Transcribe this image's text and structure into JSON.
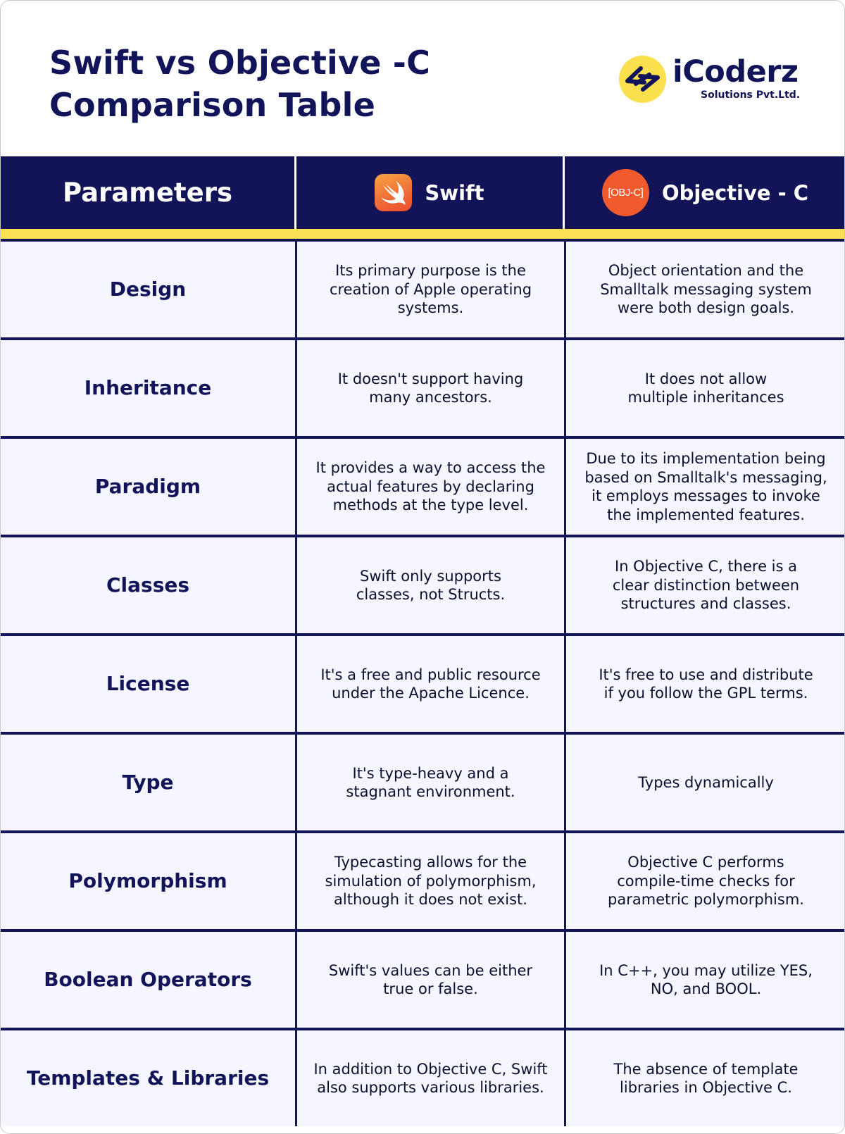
{
  "header": {
    "title_line1": "Swift vs Objective -C",
    "title_line2": "Comparison Table",
    "logo": {
      "icon": "code-brackets-icon",
      "name": "iCoderz",
      "subtitle": "Solutions Pvt.Ltd.",
      "accent_color": "#fbe04d"
    }
  },
  "table": {
    "colors": {
      "header_bg": "#121457",
      "accent_bar": "#fde255",
      "row_bg": "#f4f5fe"
    },
    "columns": [
      {
        "label": "Parameters"
      },
      {
        "label": "Swift",
        "icon": "swift-logo-icon"
      },
      {
        "label": "Objective - C",
        "icon": "objc-logo-icon",
        "icon_text": "[OBJ-C]"
      }
    ],
    "rows": [
      {
        "parameter": "Design",
        "swift": "Its primary purpose is the\ncreation of Apple operating\nsystems.",
        "objc": "Object orientation and the\nSmalltalk messaging system\nwere both design goals."
      },
      {
        "parameter": "Inheritance",
        "swift": "It doesn't support having\nmany ancestors.",
        "objc": "It does not allow\nmultiple inheritances"
      },
      {
        "parameter": "Paradigm",
        "swift": "It provides a way to access the\nactual features by declaring\nmethods at the type level.",
        "objc": "Due to its implementation being\nbased on Smalltalk's messaging,\nit employs messages to invoke\nthe implemented features."
      },
      {
        "parameter": "Classes",
        "swift": "Swift only supports\nclasses, not Structs.",
        "objc": "In Objective C, there is a\nclear distinction between\nstructures and classes."
      },
      {
        "parameter": "License",
        "swift": "It's a free and public resource\nunder the Apache Licence.",
        "objc": "It's free to use and distribute\nif you follow the GPL terms."
      },
      {
        "parameter": "Type",
        "swift": "It's type-heavy and a\nstagnant environment.",
        "objc": "Types dynamically"
      },
      {
        "parameter": "Polymorphism",
        "swift": "Typecasting allows for the\nsimulation of polymorphism,\nalthough it does not exist.",
        "objc": "Objective C performs\ncompile-time checks for\nparametric polymorphism."
      },
      {
        "parameter": "Boolean Operators",
        "swift": "Swift's values can be either\ntrue or false.",
        "objc": "In C++, you may utilize YES,\nNO, and BOOL."
      },
      {
        "parameter": "Templates & Libraries",
        "swift": "In addition to Objective C, Swift\nalso supports various libraries.",
        "objc": "The absence of template\nlibraries in Objective C."
      }
    ]
  }
}
